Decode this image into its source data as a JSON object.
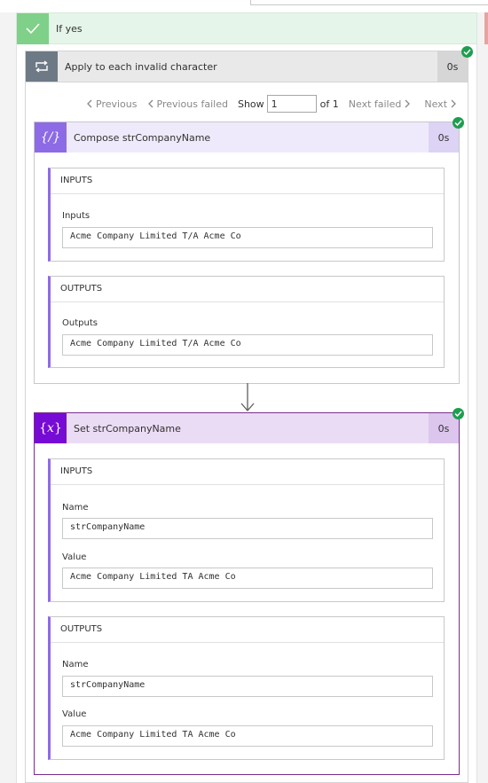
{
  "condition": {
    "label": "If yes"
  },
  "loop": {
    "title": "Apply to each invalid character",
    "duration": "0s",
    "pager": {
      "previous": "Previous",
      "previous_failed": "Previous failed",
      "show": "Show",
      "current": "1",
      "of": "of 1",
      "next_failed": "Next failed",
      "next": "Next"
    }
  },
  "compose": {
    "title": "Compose strCompanyName",
    "duration": "0s",
    "inputs": {
      "header": "INPUTS",
      "label": "Inputs",
      "value": "Acme Company Limited T/A Acme Co"
    },
    "outputs": {
      "header": "OUTPUTS",
      "label": "Outputs",
      "value": "Acme Company Limited T/A Acme Co"
    }
  },
  "setvar": {
    "title": "Set strCompanyName",
    "duration": "0s",
    "inputs": {
      "header": "INPUTS",
      "name_label": "Name",
      "name_value": "strCompanyName",
      "value_label": "Value",
      "value_value": "Acme Company Limited TA Acme Co"
    },
    "outputs": {
      "header": "OUTPUTS",
      "name_label": "Name",
      "name_value": "strCompanyName",
      "value_label": "Value",
      "value_value": "Acme Company Limited TA Acme Co"
    }
  },
  "colors": {
    "success_green": "#1e9e4f",
    "condition_green": "#7fd088",
    "compose_purple": "#8e6be6",
    "variable_purple": "#770bd6",
    "loop_gray": "#6d7a86"
  },
  "icons": {
    "condition": "checkmark-icon",
    "loop": "loop-icon",
    "compose": "compose-icon",
    "variable": "variable-icon",
    "status": "success-check-icon"
  }
}
